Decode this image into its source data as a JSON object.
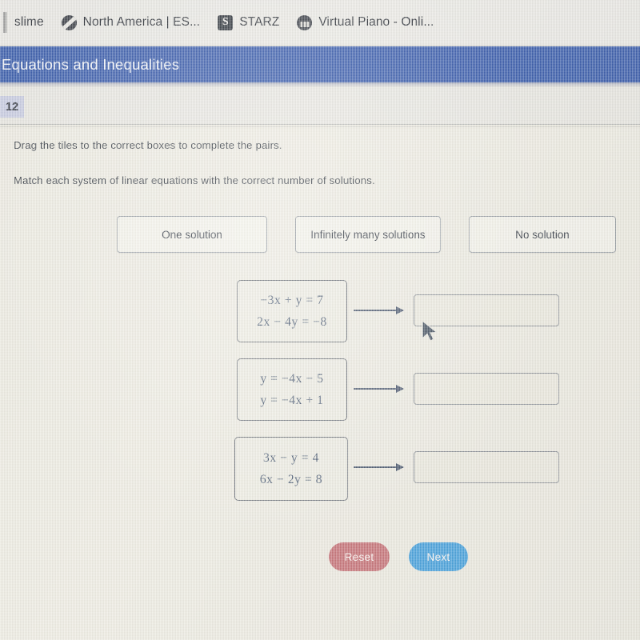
{
  "browser": {
    "bookmarks": [
      {
        "label": "slime",
        "icon": "none"
      },
      {
        "label": "North America | ES...",
        "icon": "espn-icon"
      },
      {
        "label": "STARZ",
        "icon": "starz-icon",
        "icon_text": "S"
      },
      {
        "label": "Virtual Piano - Onli...",
        "icon": "piano-icon"
      }
    ]
  },
  "header": {
    "title": "Equations and Inequalities",
    "accent_color": "#3c5eac",
    "question_number": "12"
  },
  "instructions": {
    "line1": "Drag the tiles to the correct boxes to complete the pairs.",
    "line2": "Match each system of linear equations with the correct number of solutions."
  },
  "tiles": [
    {
      "label": "One solution"
    },
    {
      "label": "Infinitely many solutions"
    },
    {
      "label": "No solution"
    }
  ],
  "pairs": [
    {
      "equations": [
        "−3x + y = 7",
        "2x − 4y = −8"
      ],
      "answer": ""
    },
    {
      "equations": [
        "y = −4x − 5",
        "y = −4x + 1"
      ],
      "answer": ""
    },
    {
      "equations": [
        "3x − y = 4",
        "6x − 2y = 8"
      ],
      "answer": ""
    }
  ],
  "buttons": {
    "reset": "Reset",
    "next": "Next",
    "reset_color": "#c8767b",
    "next_color": "#4aa3dd"
  }
}
